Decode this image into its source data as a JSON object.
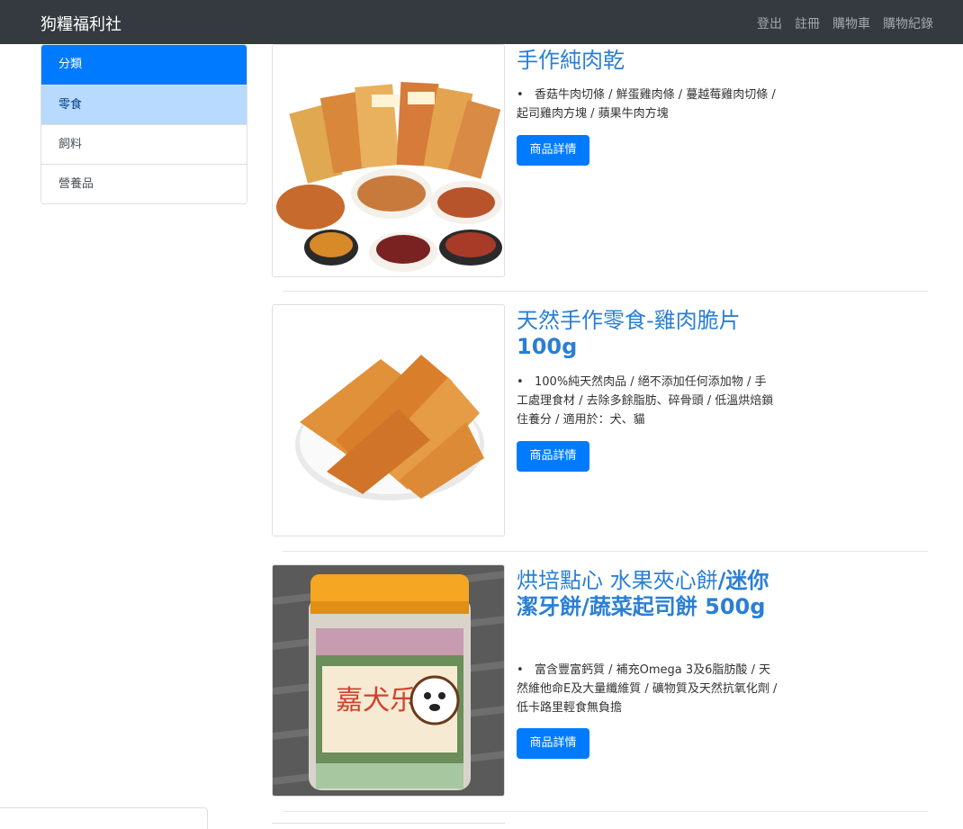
{
  "navbar": {
    "brand": "狗糧福利社",
    "links": [
      "登出",
      "註冊",
      "購物車",
      "購物紀錄"
    ]
  },
  "sidebar": {
    "items": [
      {
        "label": "分類"
      },
      {
        "label": "零食"
      },
      {
        "label": "飼料"
      },
      {
        "label": "營養品"
      }
    ]
  },
  "products": [
    {
      "title": "手作純肉乾",
      "description": "香菇牛肉切條 / 鮮蛋雞肉條 / 蔓越莓雞肉切條 / 起司雞肉方塊 / 蘋果牛肉方塊",
      "button": "商品詳情",
      "image": "jerky-assortment"
    },
    {
      "title": "天然手作零食-雞肉脆片",
      "title_bold": "100g",
      "description": "100%純天然肉品 / 絕不添加任何添加物 / 手工處理食材 / 去除多餘脂肪、碎骨頭 / 低溫烘焙鎖住養分 / 適用於：犬、貓",
      "button": "商品詳情",
      "image": "chicken-chips"
    },
    {
      "title": "烘培點心 水果夾心餅",
      "title_bold": "/迷你潔牙餅/蔬菜起司餅 500g",
      "description": "富含豐富鈣質 / 補充Omega 3及6脂肪酸 / 天然維他命E及大量纖維質 / 礦物質及天然抗氧化劑 / 低卡路里輕食無負擔",
      "button": "商品詳情",
      "image": "biscuit-jar"
    }
  ],
  "colors": {
    "navbar": "#343a40",
    "primary": "#007bff",
    "active": "#b8daff",
    "title": "#2a7fd4"
  }
}
